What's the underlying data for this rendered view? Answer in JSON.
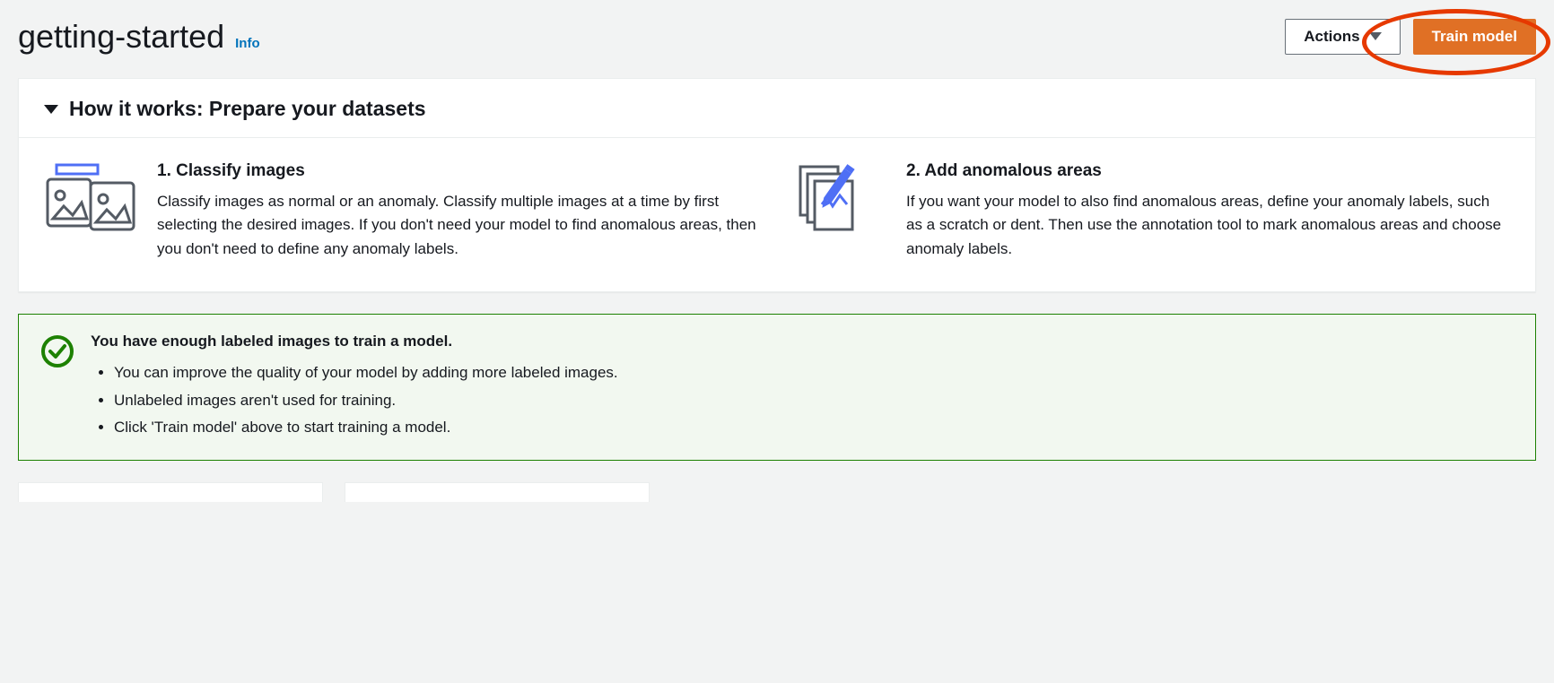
{
  "header": {
    "title": "getting-started",
    "info_label": "Info",
    "actions_label": "Actions",
    "train_label": "Train model"
  },
  "how_it_works": {
    "title": "How it works: Prepare your datasets",
    "steps": [
      {
        "title": "1. Classify images",
        "desc": "Classify images as normal or an anomaly. Classify multiple images at a time by first selecting the desired images. If you don't need your model to find anomalous areas, then you don't need to define any anomaly labels."
      },
      {
        "title": "2. Add anomalous areas",
        "desc": "If you want your model to also find anomalous areas, define your anomaly labels, such as a scratch or dent. Then use the annotation tool to mark anomalous areas and choose anomaly labels."
      }
    ]
  },
  "alert": {
    "title": "You have enough labeled images to train a model.",
    "items": [
      "You can improve the quality of your model by adding more labeled images.",
      "Unlabeled images aren't used for training.",
      "Click 'Train model' above to start training a model."
    ]
  }
}
